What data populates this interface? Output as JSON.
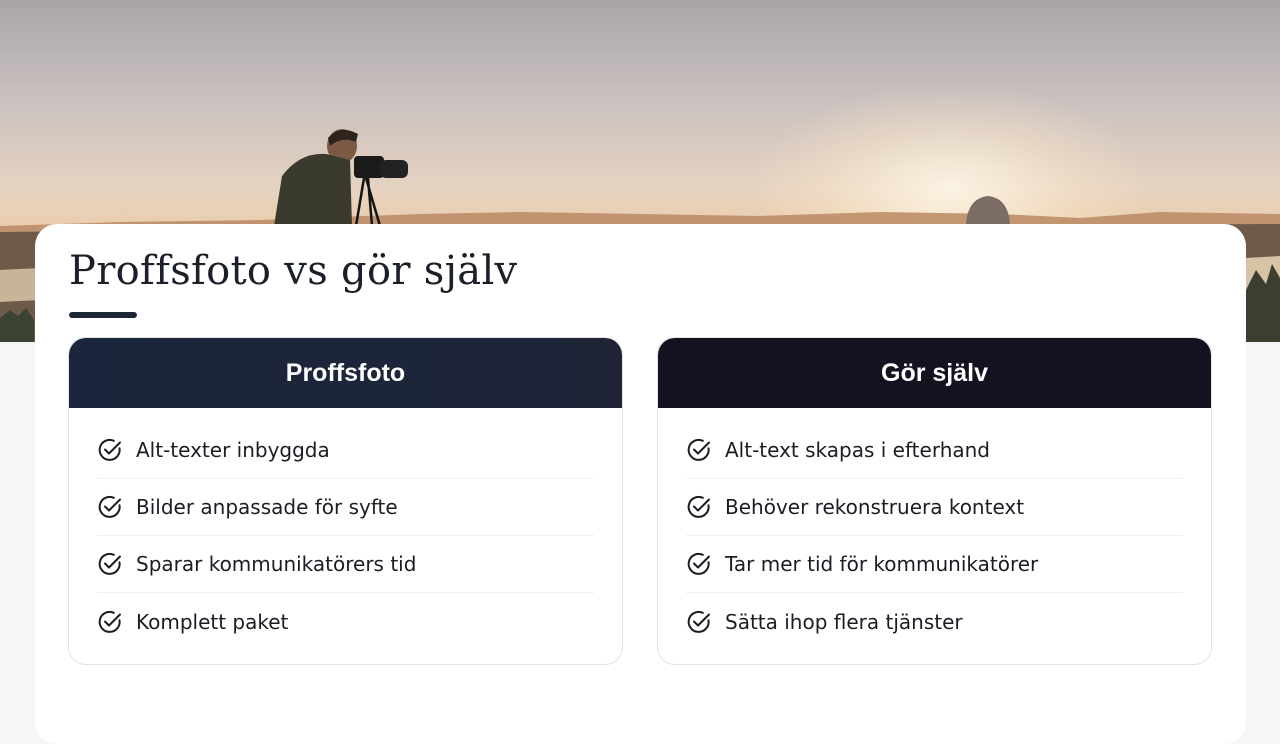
{
  "title": "Proffsfoto vs gör själv",
  "hero": {
    "image": "photographer-at-sunset-landscape"
  },
  "colors": {
    "accent_dark": "#1d2637",
    "left_header": "#1b263c",
    "right_header": "#141220",
    "text": "#1c1c24"
  },
  "columns": [
    {
      "heading": "Proffsfoto",
      "icon": "check-circle-icon",
      "items": [
        "Alt-texter inbyggda",
        "Bilder anpassade för syfte",
        "Sparar kommunikatörers tid",
        "Komplett paket"
      ]
    },
    {
      "heading": "Gör själv",
      "icon": "check-circle-icon",
      "items": [
        "Alt-text skapas i efterhand",
        "Behöver rekonstruera kontext",
        "Tar mer tid för kommunikatörer",
        "Sätta ihop flera tjänster"
      ]
    }
  ]
}
